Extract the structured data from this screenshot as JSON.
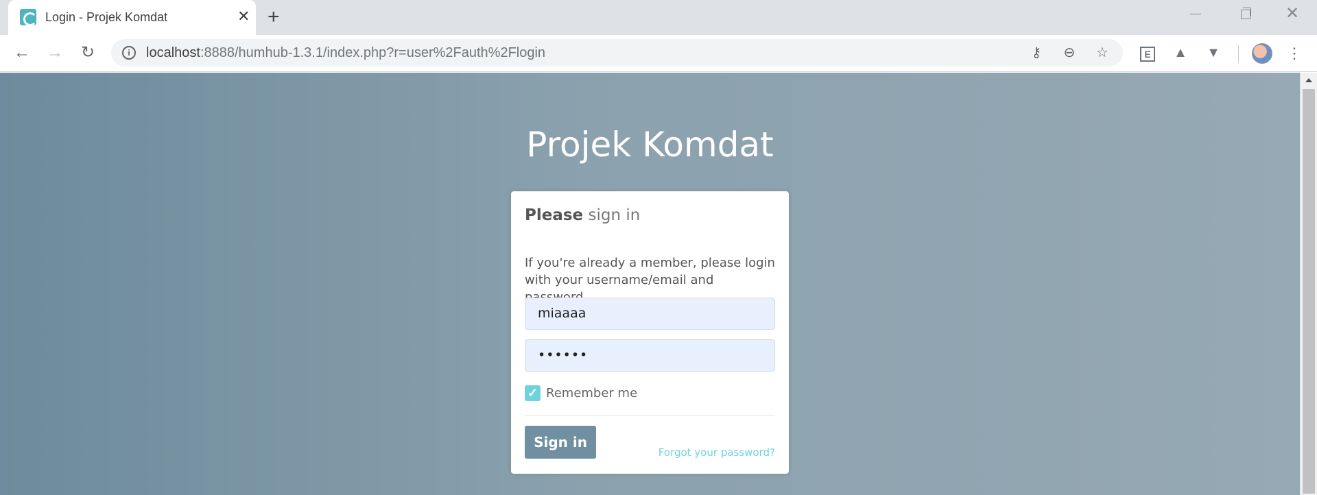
{
  "browser": {
    "tab": {
      "title": "Login - Projek Komdat",
      "favicon": "humhub-favicon-icon"
    },
    "address": {
      "host": "localhost",
      "rest": ":8888/humhub-1.3.1/index.php?r=user%2Fauth%2Flogin"
    }
  },
  "page": {
    "brand_title": "Projek Komdat",
    "login": {
      "heading_bold": "Please",
      "heading_light": "sign in",
      "description": "If you're already a member, please login with your username/email and password.",
      "username_value": "miaaaa",
      "password_value": "••••••",
      "remember_label": "Remember me",
      "remember_checked": true,
      "submit_label": "Sign in",
      "forgot_label": "Forgot your password?"
    }
  },
  "colors": {
    "accent": "#6fd3df",
    "button": "#708fa0",
    "background_start": "#6d8b9c",
    "background_end": "#96a9b4"
  }
}
